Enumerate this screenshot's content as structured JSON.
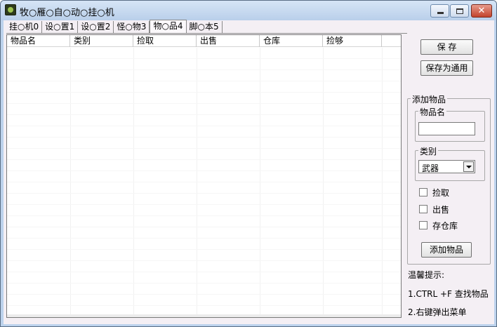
{
  "window": {
    "title": "牧○雁○自○动○挂○机",
    "min_label": "",
    "max_label": "",
    "close_label": "✕"
  },
  "tabs": [
    {
      "label": "挂○机0"
    },
    {
      "label": "设○置1"
    },
    {
      "label": "设○置2"
    },
    {
      "label": "怪○物3"
    },
    {
      "label": "物○品4",
      "active": true
    },
    {
      "label": "脚○本5"
    }
  ],
  "list": {
    "columns": [
      "物品名",
      "类别",
      "捡取",
      "出售",
      "仓库",
      "捡够"
    ],
    "rows": []
  },
  "buttons": {
    "save": "保 存",
    "save_common": "保存为通用",
    "add_item": "添加物品"
  },
  "add_group": {
    "title": "添加物品",
    "name_label": "物品名",
    "name_value": "",
    "category_label": "类别",
    "category_value": "武器"
  },
  "checkboxes": {
    "pick": "捡取",
    "sell": "出售",
    "store": "存仓库"
  },
  "tips": {
    "title": "温馨提示:",
    "line1": "1.CTRL +F 查找物品",
    "line2": "2.右键弹出菜单"
  }
}
